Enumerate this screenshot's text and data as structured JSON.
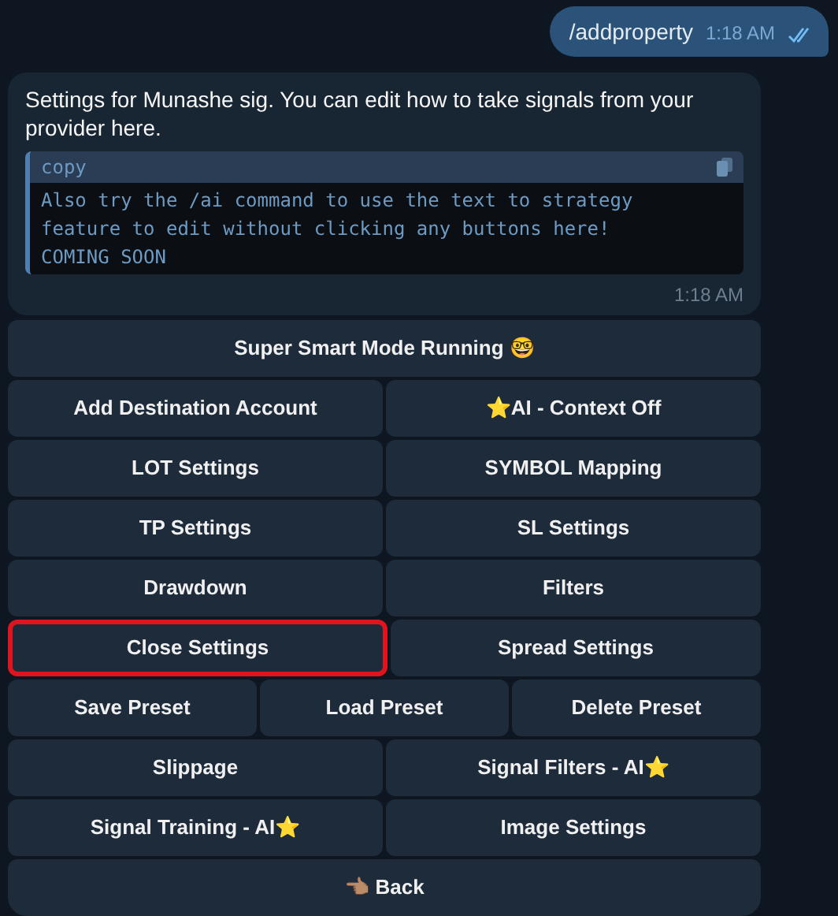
{
  "outgoing": {
    "text": "/addproperty",
    "time": "1:18 AM",
    "read": true
  },
  "incoming": {
    "text": "Settings for Munashe sig. You can edit how to take signals from your provider here.",
    "code": {
      "label": "copy",
      "text": "Also try the /ai command to use the text to strategy feature to edit without clicking any buttons here!\nCOMING SOON"
    },
    "time": "1:18 AM"
  },
  "keyboard": [
    [
      {
        "label": "Super Smart Mode Running 🤓",
        "highlighted": false
      }
    ],
    [
      {
        "label": "Add Destination Account",
        "highlighted": false
      },
      {
        "label": "⭐AI - Context Off",
        "highlighted": false
      }
    ],
    [
      {
        "label": "LOT Settings",
        "highlighted": false
      },
      {
        "label": "SYMBOL Mapping",
        "highlighted": false
      }
    ],
    [
      {
        "label": "TP Settings",
        "highlighted": false
      },
      {
        "label": "SL Settings",
        "highlighted": false
      }
    ],
    [
      {
        "label": "Drawdown",
        "highlighted": false
      },
      {
        "label": "Filters",
        "highlighted": false
      }
    ],
    [
      {
        "label": "Close Settings",
        "highlighted": true
      },
      {
        "label": "Spread Settings",
        "highlighted": false
      }
    ],
    [
      {
        "label": "Save Preset",
        "highlighted": false
      },
      {
        "label": "Load Preset",
        "highlighted": false
      },
      {
        "label": "Delete Preset",
        "highlighted": false
      }
    ],
    [
      {
        "label": "Slippage",
        "highlighted": false
      },
      {
        "label": "Signal Filters - AI⭐",
        "highlighted": false
      }
    ],
    [
      {
        "label": "Signal Training - AI⭐",
        "highlighted": false
      },
      {
        "label": "Image Settings",
        "highlighted": false
      }
    ],
    [
      {
        "label": "👈🏽 Back",
        "highlighted": false
      }
    ]
  ]
}
